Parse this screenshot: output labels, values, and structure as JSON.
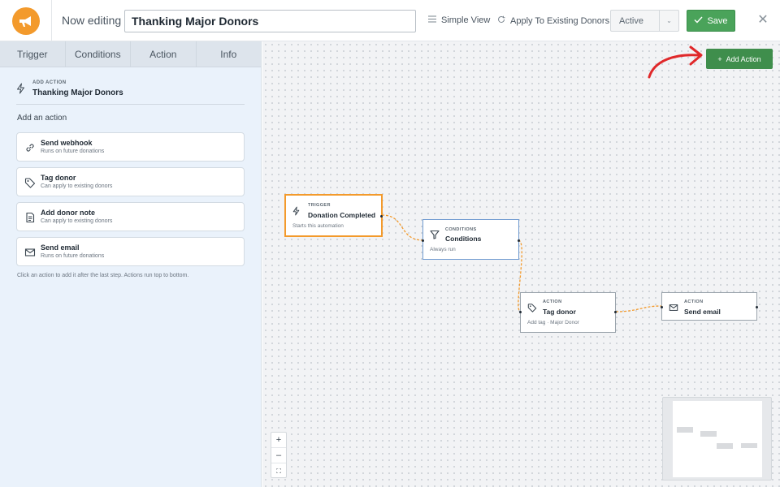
{
  "header": {
    "now_editing_label": "Now editing",
    "automation_name": "Thanking Major Donors",
    "simple_view_label": "Simple View",
    "apply_existing_label": "Apply To Existing Donors",
    "status_value": "Active",
    "save_label": "Save",
    "close_icon": "close-icon"
  },
  "sidebar": {
    "tabs": [
      {
        "label": "Trigger"
      },
      {
        "label": "Conditions"
      },
      {
        "label": "Action"
      },
      {
        "label": "Info"
      }
    ],
    "panel": {
      "kicker": "ADD ACTION",
      "title": "Thanking Major Donors",
      "section_label": "Add an action",
      "actions": [
        {
          "title": "Send webhook",
          "subtitle": "Runs on future donations",
          "icon": "link-icon"
        },
        {
          "title": "Tag donor",
          "subtitle": "Can apply to existing donors",
          "icon": "tag-icon"
        },
        {
          "title": "Add donor note",
          "subtitle": "Can apply to existing donors",
          "icon": "note-icon"
        },
        {
          "title": "Send email",
          "subtitle": "Runs on future donations",
          "icon": "mail-icon"
        }
      ],
      "hint": "Click an action to add it after the last step. Actions run top to bottom."
    }
  },
  "canvas": {
    "add_action_label": "Add Action",
    "nodes": {
      "trigger": {
        "kicker": "TRIGGER",
        "title": "Donation Completed",
        "detail": "Starts this automation"
      },
      "conditions": {
        "kicker": "CONDITIONS",
        "title": "Conditions",
        "detail": "Always run"
      },
      "tag": {
        "kicker": "ACTION",
        "title": "Tag donor",
        "detail": "Add tag · Major Donor"
      },
      "email": {
        "kicker": "ACTION",
        "title": "Send email"
      }
    },
    "zoom": {
      "in": "+",
      "out": "–",
      "fit": "⛶"
    }
  },
  "colors": {
    "brand_orange": "#f39a2c",
    "save_green": "#4aa35a",
    "add_action_green": "#3f8e4c",
    "selected_node_border": "#f39a2c",
    "conditions_node_border": "#6f9ad0",
    "connector": "#f39a2c",
    "annotation_arrow": "#e0282a"
  }
}
